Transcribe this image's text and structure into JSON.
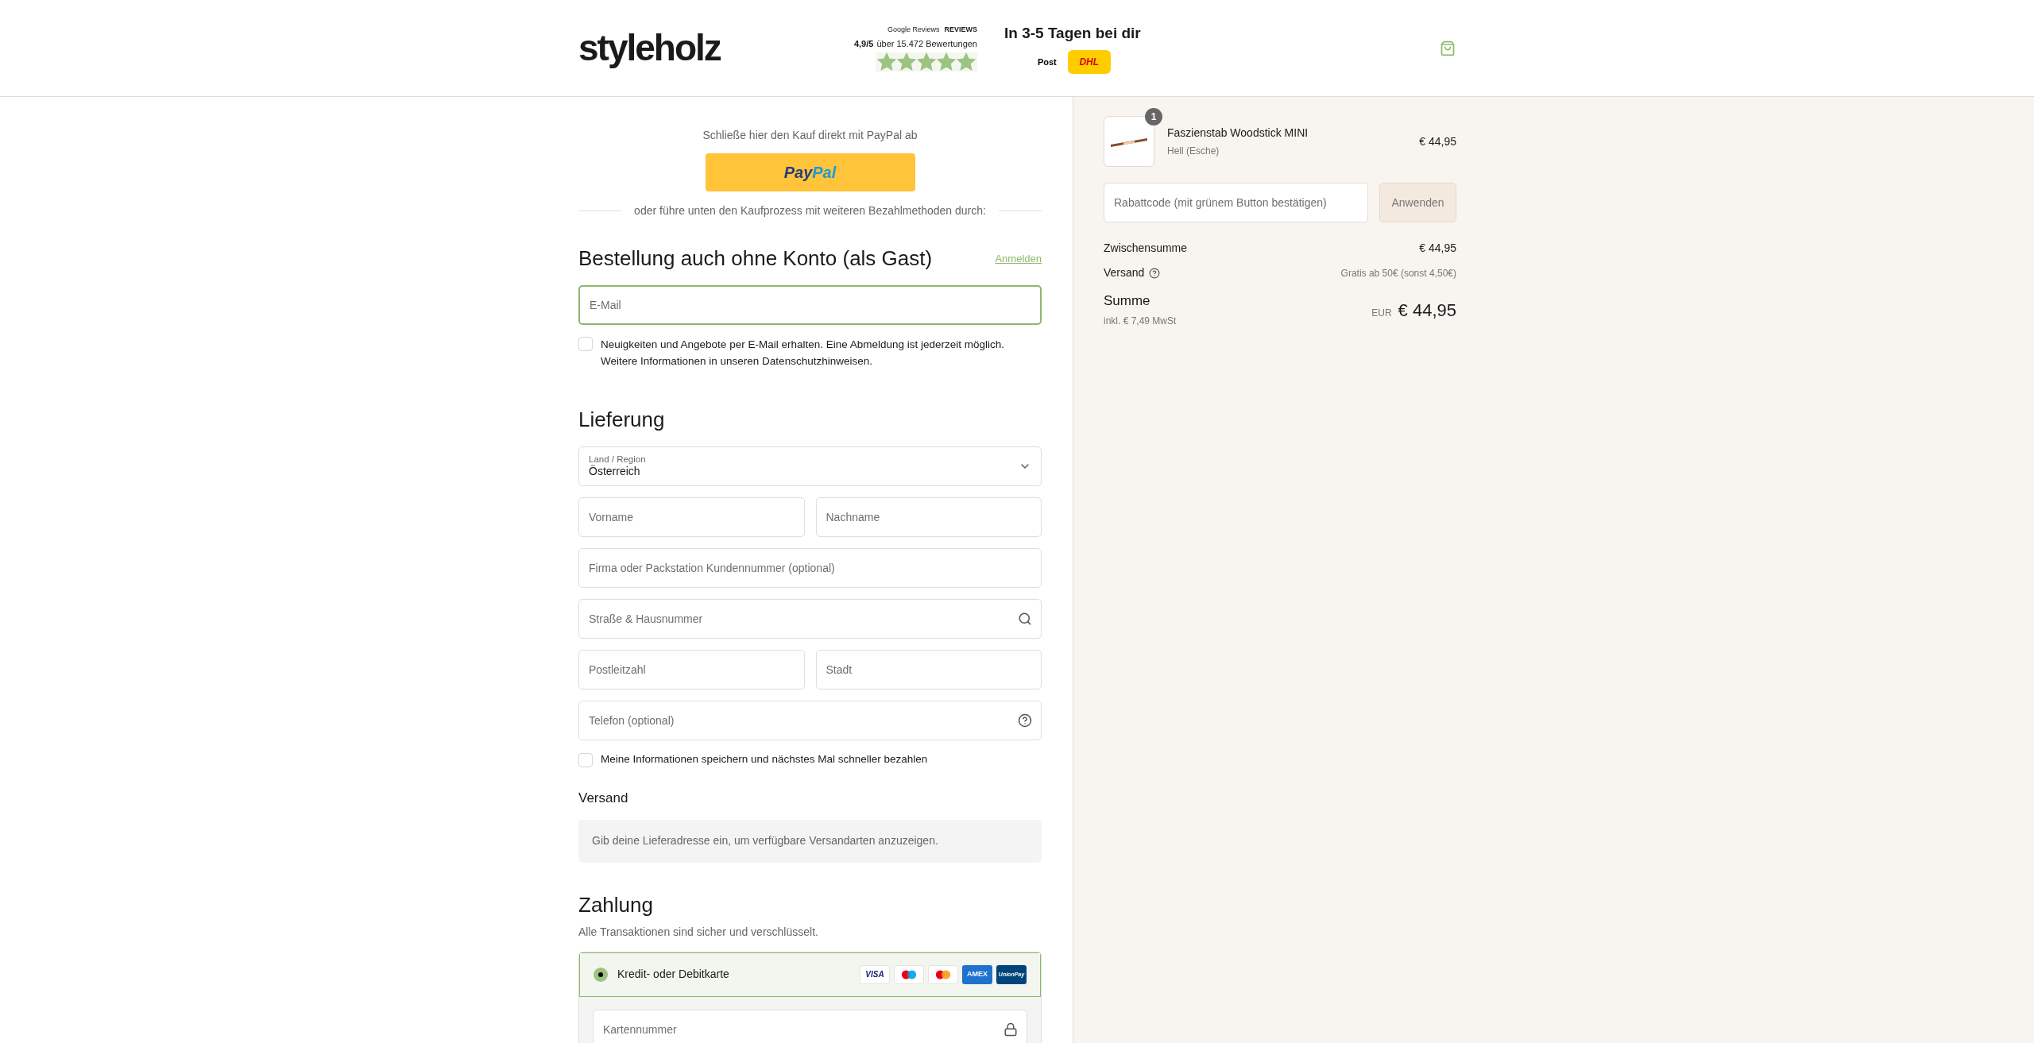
{
  "header": {
    "logo": "styleholz",
    "reviews": {
      "google": "Google Reviews",
      "reviews_io": "REVIEWS",
      "rating": "4,9/5",
      "count": "über 15.472 Bewertungen",
      "stars": 5
    },
    "delivery": {
      "title": "In 3-5 Tagen bei dir",
      "carriers": [
        {
          "kind": "post",
          "label": "Post"
        },
        {
          "kind": "dhl",
          "label": "DHL"
        }
      ]
    }
  },
  "express": {
    "intro": "Schließe hier den Kauf direkt mit PayPal ab",
    "paypal": [
      "Pay",
      "Pal"
    ],
    "divider": "oder führe unten den Kaufprozess mit weiteren Bezahlmethoden durch:"
  },
  "contact": {
    "title": "Bestellung auch ohne Konto (als Gast)",
    "login": "Anmelden",
    "email": {
      "placeholder": "E-Mail",
      "focused": true
    },
    "newsletter": {
      "label": "Neuigkeiten und Angebote per E-Mail erhalten. Eine Abmeldung ist jederzeit möglich. Weitere Informationen in unseren Datenschutzhinweisen.",
      "checked": false
    }
  },
  "delivery": {
    "title": "Lieferung",
    "country": {
      "label": "Land / Region",
      "value": "Österreich"
    },
    "rows": [
      [
        {
          "placeholder": "Vorname"
        },
        {
          "placeholder": "Nachname"
        }
      ],
      [
        {
          "placeholder": "Firma oder Packstation Kundennummer (optional)"
        }
      ],
      [
        {
          "placeholder": "Straße & Hausnummer",
          "kind": "address"
        }
      ],
      [
        {
          "placeholder": "Postleitzahl"
        },
        {
          "placeholder": "Stadt"
        }
      ],
      [
        {
          "placeholder": "Telefon (optional)",
          "kind": "phone"
        }
      ]
    ],
    "save": {
      "label": "Meine Informationen speichern und nächstes Mal schneller bezahlen",
      "checked": false
    }
  },
  "shipping": {
    "title": "Versand",
    "notice": "Gib deine Lieferadresse ein, um verfügbare Versandarten anzuzeigen."
  },
  "payment": {
    "title": "Zahlung",
    "subtitle": "Alle Transaktionen sind sicher und verschlüsselt.",
    "method": {
      "label": "Kredit- oder Debitkarte",
      "selected": true
    },
    "cards": [
      {
        "kind": "visa",
        "label": "VISA"
      },
      {
        "kind": "maestro"
      },
      {
        "kind": "mastercard"
      },
      {
        "kind": "amex",
        "label": "AMEX"
      },
      {
        "kind": "unionpay",
        "label": "UnionPay"
      }
    ],
    "card_number": {
      "placeholder": "Kartennummer"
    }
  },
  "cart": {
    "items": [
      {
        "name": "Faszienstab Woodstick MINI",
        "variant": "Hell (Esche)",
        "price": "€ 44,95",
        "quantity": "1"
      }
    ],
    "discount": {
      "placeholder": "Rabattcode (mit grünem Button bestätigen)",
      "button": "Anwenden"
    },
    "subtotal": {
      "label": "Zwischensumme",
      "value": "€ 44,95"
    },
    "shipping": {
      "label": "Versand",
      "value": "Gratis ab 50€ (sonst 4,50€)"
    },
    "total": {
      "label": "Summe",
      "tax": "inkl. € 7,49 MwSt",
      "currency": "EUR",
      "value": "€ 44,95"
    }
  }
}
